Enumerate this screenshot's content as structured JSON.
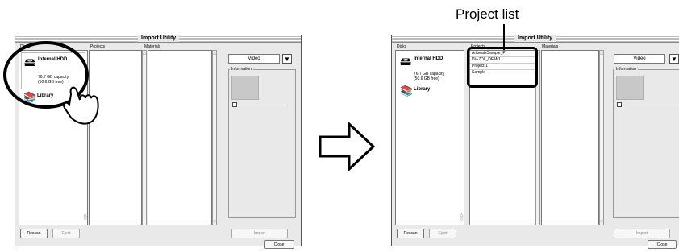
{
  "callout": "Project list",
  "window_title": "Import Utility",
  "columns": {
    "disks": "Disks",
    "projects": "Projects",
    "materials": "Materials"
  },
  "disks": [
    {
      "name": "Internal HDD",
      "capacity": "76.7 GB capacity",
      "free": "(50.6 GB free)"
    },
    {
      "name": "Library"
    }
  ],
  "projects": [
    "ArtbeatsSample_P",
    "DV-7DL_DEMO",
    "Project-1",
    "Sample"
  ],
  "video_select": "Video",
  "information_label": "Information",
  "buttons": {
    "rescan": "Rescan",
    "eject": "Eject",
    "import": "Import",
    "close": "Close"
  },
  "colors": {
    "highlight": "#000000",
    "window_bg": "#e9e9e9",
    "preview": "#c8c8c8"
  }
}
